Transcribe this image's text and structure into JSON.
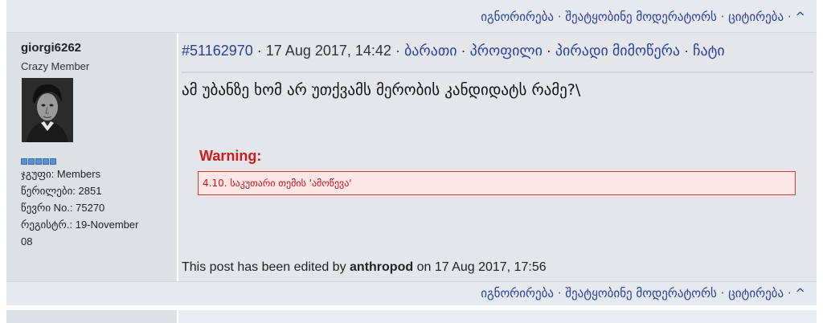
{
  "top_links": {
    "ignore": "იგნორირება",
    "report": "შეატყობინე მოდერატორს",
    "quote": "ციტირება",
    "up": "^",
    "sep": "·"
  },
  "post": {
    "author": {
      "username": "giorgi6262",
      "rank": "Crazy Member",
      "group": "ჯგუფი: Members",
      "posts": "წერილები: 2851",
      "member_no": "წევრი No.: 75270",
      "registered_line1": "რეგისტრ.: 19-November",
      "registered_line2": "08",
      "rank_pips": 5
    },
    "id": "#51162970",
    "datetime": "17 Aug 2017, 14:42",
    "header_links": {
      "card": "ბარათი",
      "profile": "პროფილი",
      "pm": "პირადი მიმოწერა",
      "chat": "ჩატი"
    },
    "body": "ამ უბანზე ხომ არ უთქვამს მერობის კანდიდატს რამე?\\",
    "warning_title": "Warning:",
    "warning_text": "4.10. საკუთარი თემის 'ამოწევა'",
    "edited_prefix": "This post has been edited by ",
    "edited_by": "anthropod",
    "edited_suffix": " on 17 Aug 2017, 17:56"
  },
  "colors": {
    "link": "#2a3f9e",
    "warning": "#d01919",
    "warning_bg": "#fde6e6"
  }
}
